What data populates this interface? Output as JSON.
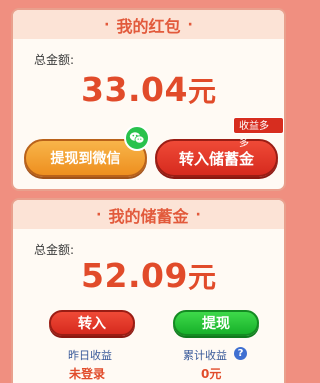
{
  "red_packet": {
    "title": "我的红包",
    "dot": "·",
    "total_label": "总金额:",
    "amount": "33.04",
    "unit": "元",
    "withdraw_button": "提现到微信",
    "transfer_button": "转入储蓄金",
    "badge": "收益多多"
  },
  "savings": {
    "title": "我的储蓄金",
    "dot": "·",
    "total_label": "总金额:",
    "amount": "52.09",
    "unit": "元",
    "transfer_in_button": "转入",
    "withdraw_button": "提现",
    "yesterday_label": "昨日收益",
    "yesterday_value": "未登录",
    "cumulative_label": "累计收益",
    "cumulative_value": "0元",
    "help_glyph": "?"
  },
  "colors": {
    "background": "#f08f80",
    "accent_red": "#e14b2a",
    "orange": "#ee8f1f",
    "green": "#17b12a",
    "wechat": "#29c24d"
  }
}
